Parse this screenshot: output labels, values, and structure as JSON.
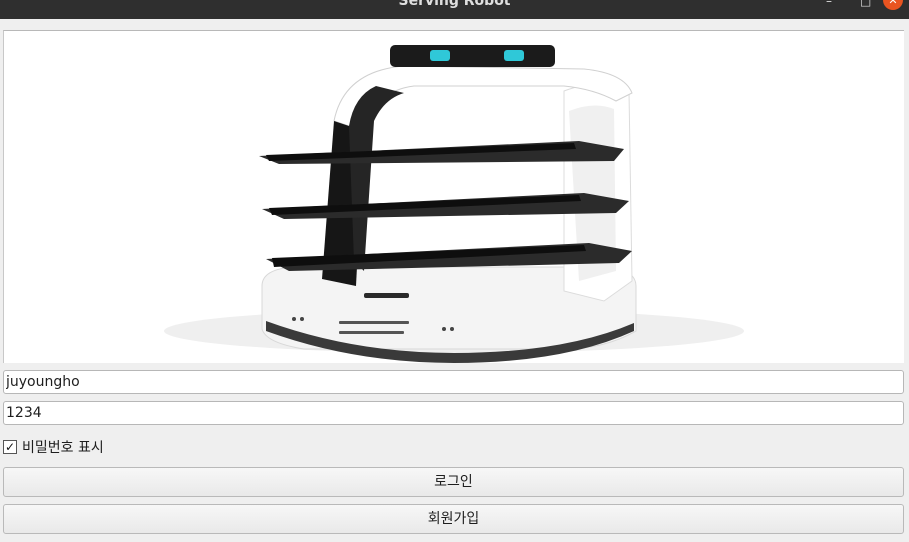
{
  "window": {
    "title": "Serving Robot",
    "minimize_glyph": "–",
    "maximize_glyph": "□",
    "close_glyph": "✕"
  },
  "login": {
    "username_value": "juyoungho",
    "password_value": "1234",
    "show_password_label": "비밀번호 표시",
    "show_password_checked": true,
    "check_glyph": "✓",
    "login_button_label": "로그인",
    "signup_button_label": "회원가입"
  }
}
